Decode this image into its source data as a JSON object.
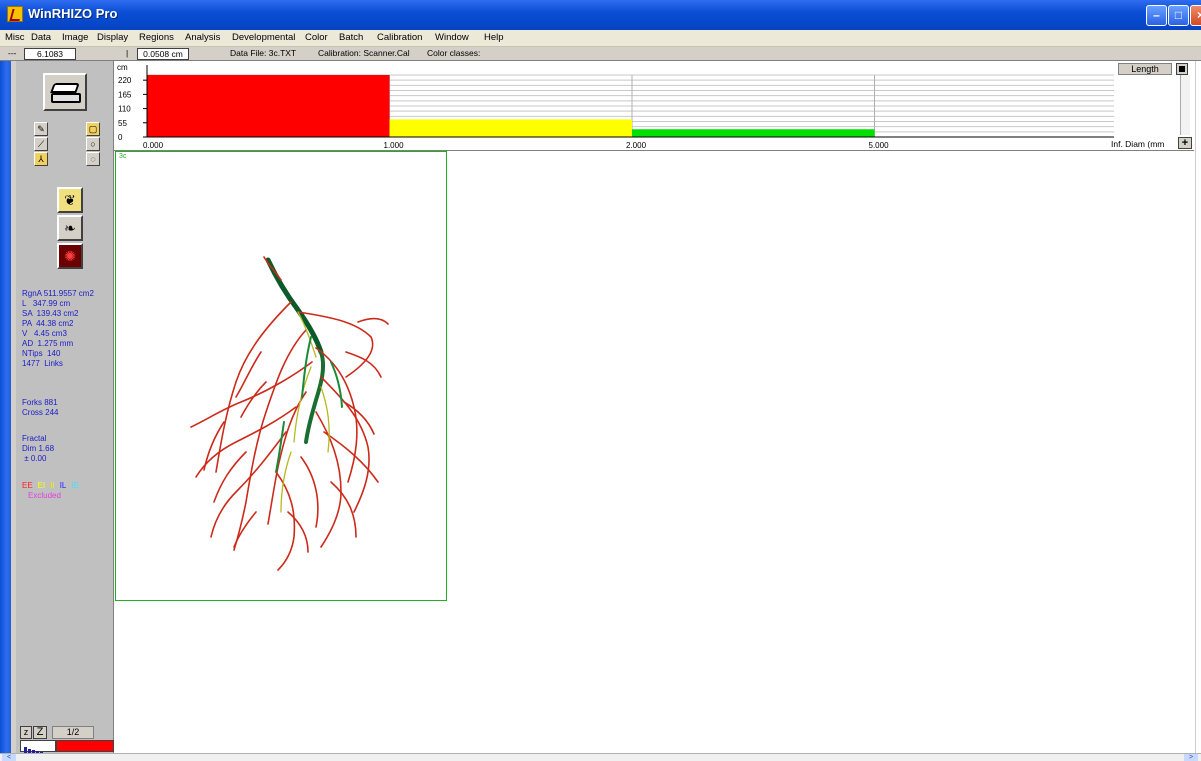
{
  "window": {
    "title": "WinRHIZO Pro"
  },
  "menu": [
    "Misc",
    "Data",
    "Image",
    "Display",
    "Regions",
    "Analysis",
    "Developmental",
    "Color",
    "Batch",
    "Calibration",
    "Window",
    "Help"
  ],
  "infobar": {
    "dash": "---",
    "value1": "6.1083",
    "sep": "|",
    "value2": "0.0508 cm",
    "data_file": "Data File: 3c.TXT",
    "calibration": "Calibration: Scanner.Cal",
    "color_classes": "Color classes:"
  },
  "stats": {
    "rgna": "RgnA 511.9557 cm2",
    "l": "L   347.99 cm",
    "sa": "SA  139.43 cm2",
    "pa": "PA  44.38 cm2",
    "v": "V   4.45 cm3",
    "ad": "AD  1.275 mm",
    "ntips": "NTips  140",
    "links": "1477  Links",
    "forks": "Forks 881",
    "cross": "Cross 244",
    "fractal": "Fractal",
    "dim": "Dim 1.68",
    "pm": " ± 0.00"
  },
  "legend": {
    "ee": "EE",
    "ei": "EI",
    "ii": "II",
    "il": "IL",
    "ie": "IE",
    "excluded": "Excluded",
    "colors": {
      "ee": "#ff2020",
      "ei": "#ffff00",
      "ii": "#f0f000",
      "il": "#2020ff",
      "ie": "#40e0ff",
      "excluded": "#e040e0"
    }
  },
  "bottom_controls": {
    "z1": "z",
    "z2": "Z",
    "page": "1/2"
  },
  "histogram": {
    "length_label": "Length",
    "plus": "+",
    "x_unit": "Inf. Diam (mm",
    "corner": "3c"
  },
  "chart_data": {
    "type": "bar",
    "ylabel": "cm",
    "yticks": [
      "0",
      "55",
      "110",
      "165",
      "220"
    ],
    "ylim": [
      0,
      240
    ],
    "xticks": [
      "0.000",
      "1.000",
      "2.000",
      "5.000"
    ],
    "categories": [
      "0.000-1.000",
      "1.000-2.000",
      "2.000-5.000",
      "5.000-Inf."
    ],
    "values": [
      240,
      68,
      30,
      0
    ],
    "colors": [
      "#ff0000",
      "#ffff00",
      "#00e000",
      "#ffffff"
    ],
    "grid": true
  },
  "scrollbar": {
    "left": "<",
    "right": ">"
  }
}
